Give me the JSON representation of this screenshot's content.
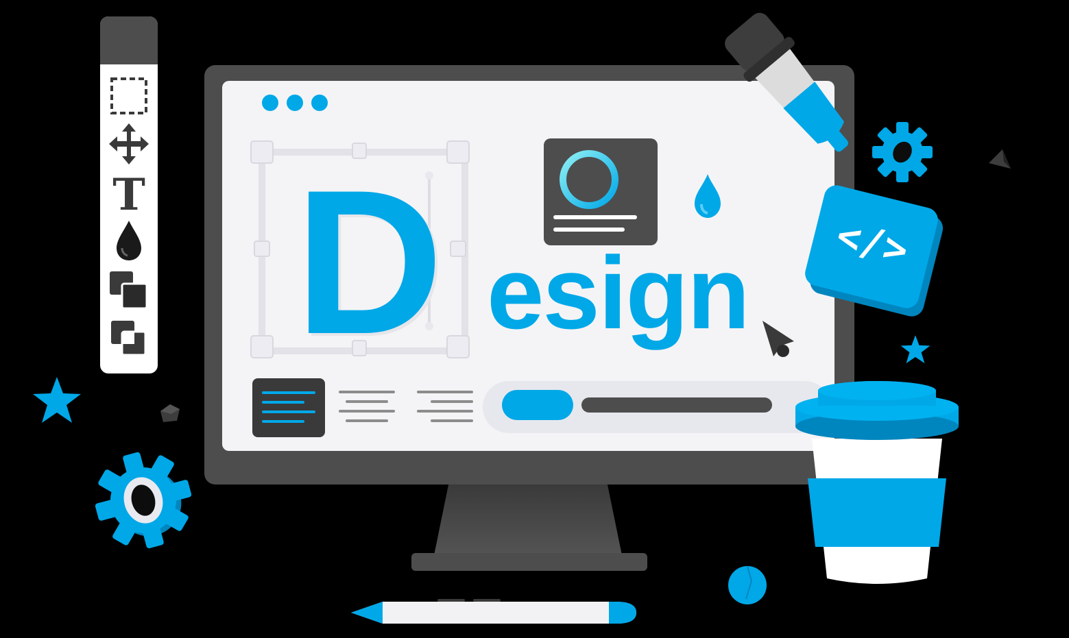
{
  "colors": {
    "accent": "#00a8e8",
    "accent_dark": "#0086bf",
    "dark_gray": "#4d4d4d",
    "screen_bg": "#f4f4f6"
  },
  "toolbar": {
    "tools": [
      "select-rect-icon",
      "move-icon",
      "text-tool-icon",
      "fill-drop-icon",
      "layers-icon",
      "arrange-icon"
    ],
    "text_tool_glyph": "T"
  },
  "screen": {
    "heading_big_letter": "D",
    "heading_rest": "esign"
  },
  "code_block": {
    "label": "</>"
  }
}
